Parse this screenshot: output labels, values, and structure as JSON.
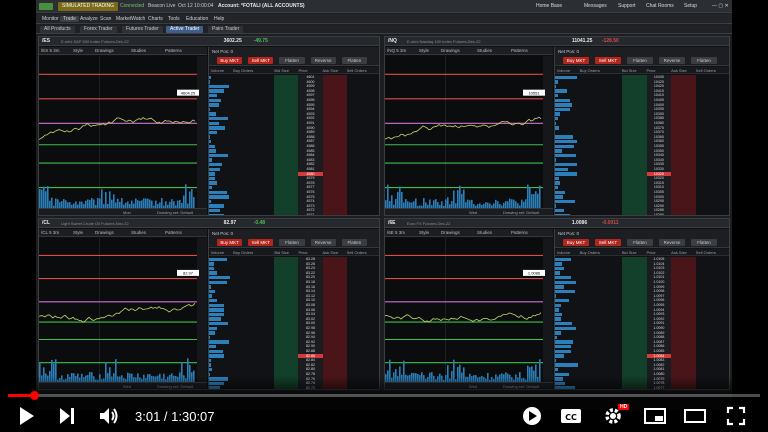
{
  "app": {
    "title_badge": "SIMULATED TRADING",
    "title_items": [
      "Connected",
      "Beacon Live",
      "Oct 12  10:00:04",
      "Account: *FOTALI (ALL ACCOUNTS)"
    ],
    "right_items": [
      "Home Base",
      "Messages",
      "Support",
      "Chat Rooms",
      "Setup"
    ],
    "menu": [
      "Monitor",
      "Trade",
      "Analyze",
      "Scan",
      "MarketWatch",
      "Charts",
      "Tools",
      "Education",
      "Help"
    ],
    "menu_active": "Trade",
    "subtabs": [
      "All Products",
      "Forex Trader",
      "Futures Trader",
      "Active Trader",
      "Pairs Trader"
    ],
    "accent": "#4a8f3c"
  },
  "panels": [
    {
      "symbol": "/ES",
      "description": "E-mini S&P 500 Index Futures,Dec-22",
      "price": "3602.25",
      "change": "-49.75",
      "chart_toolbar": [
        "/ES 5 3m",
        "Style",
        "Drawings",
        "Studies",
        "Patterns"
      ],
      "footer": [
        "Drawing set: Default"
      ],
      "net_pos": "Net Pos: 0",
      "buttons": [
        "Buy MKT",
        "Sell MKT",
        "Flatten",
        "Reverse",
        "Flatten"
      ],
      "col_headers": [
        "Volume",
        "Buy Orders",
        "Bid Size",
        "Price",
        "Ask Size",
        "Sell Orders"
      ],
      "prices": [
        "4601",
        "4600",
        "4599",
        "4598",
        "4597",
        "4596",
        "4595",
        "4594",
        "4593",
        "4592",
        "4591",
        "4590",
        "4589",
        "4588",
        "4587",
        "4586",
        "4585",
        "4584",
        "4583",
        "4582",
        "4581",
        "4580",
        "4579",
        "4578",
        "4577",
        "4576",
        "4575",
        "4574",
        "4573",
        "4572",
        "4571",
        "4570",
        "4569",
        "4568",
        "4567",
        "4566",
        "4565",
        "4564",
        "4563"
      ],
      "price_box": "4604.25",
      "chart_label": "Mon"
    },
    {
      "symbol": "/NQ",
      "description": "E-mini Nasdaq 100 Index Futures,Dec-22",
      "price": "11041.25",
      "change": "-128.50",
      "chart_toolbar": [
        "/NQ 5 3m",
        "Style",
        "Drawings",
        "Studies",
        "Patterns"
      ],
      "footer": [
        "Drawing set: Default"
      ],
      "net_pos": "Net Pos: 0",
      "buttons": [
        "Buy MKT",
        "Sell MKT",
        "Flatten",
        "Reverse",
        "Flatten"
      ],
      "col_headers": [
        "Volume",
        "Buy Orders",
        "Bid Size",
        "Price",
        "Ask Size",
        "Sell Orders"
      ],
      "summary": [
        "0",
        "0",
        "N/A",
        "0",
        "0"
      ],
      "prices": [
        "10430",
        "10425",
        "10420",
        "10415",
        "10410",
        "10405",
        "10400",
        "10395",
        "10390",
        "10385",
        "10380",
        "10375",
        "10370",
        "10365",
        "10360",
        "10355",
        "10350",
        "10345",
        "10340",
        "10335",
        "10330",
        "10325",
        "10320",
        "10315",
        "10310",
        "10305",
        "10300",
        "10295",
        "10290",
        "10285",
        "10280",
        "10275",
        "10270",
        "10265",
        "10260",
        "10255",
        "10250",
        "10245",
        "10240"
      ],
      "price_box": "10551",
      "chart_label": "Wed"
    },
    {
      "symbol": "/CL",
      "description": "Light Sweet Crude Oil Futures,Nov-22",
      "price": "82.97",
      "change": "-0.48",
      "chart_toolbar": [
        "/CL 5 3m",
        "Style",
        "Drawings",
        "Studies",
        "Patterns"
      ],
      "footer": [
        "Drawing set: Default"
      ],
      "net_pos": "Net Pos: 0",
      "buttons": [
        "Buy MKT",
        "Sell MKT",
        "Flatten",
        "Reverse",
        "Flatten"
      ],
      "col_headers": [
        "Volume",
        "Buy Orders",
        "Bid Size",
        "Price",
        "Ask Size",
        "Sell Orders"
      ],
      "summary": [
        "0",
        "0",
        "N/A",
        "0",
        "0"
      ],
      "prices": [
        "83.28",
        "83.26",
        "83.24",
        "83.22",
        "83.20",
        "83.18",
        "83.16",
        "83.14",
        "83.12",
        "83.10",
        "83.08",
        "83.06",
        "83.04",
        "83.02",
        "83.00",
        "82.98",
        "82.96",
        "82.94",
        "82.92",
        "82.90",
        "82.88",
        "82.86",
        "82.84",
        "82.82",
        "82.80",
        "82.78",
        "82.76",
        "82.74",
        "82.72",
        "82.70",
        "82.68",
        "82.66",
        "82.64",
        "82.62",
        "82.60",
        "82.58",
        "82.56",
        "82.54",
        "82.52"
      ],
      "price_box": "82.97",
      "chart_label": "Wed"
    },
    {
      "symbol": "/6E",
      "description": "Euro FX Futures,Dec-22",
      "price": "1.0086",
      "change": "-0.0011",
      "chart_toolbar": [
        "/6E 5 3m",
        "Style",
        "Drawings",
        "Studies",
        "Patterns"
      ],
      "footer": [
        "Drawing set: Default"
      ],
      "net_pos": "Net Pos: 0",
      "buttons": [
        "Buy MKT",
        "Sell MKT",
        "Flatten",
        "Reverse",
        "Flatten"
      ],
      "col_headers": [
        "Volume",
        "Buy Orders",
        "Bid Size",
        "Price",
        "Ask Size",
        "Sell Orders"
      ],
      "summary": [
        "0",
        "0",
        "N/A",
        "0",
        "0"
      ],
      "prices": [
        "1.0105",
        "1.0104",
        "1.0103",
        "1.0102",
        "1.0101",
        "1.0100",
        "1.0099",
        "1.0098",
        "1.0097",
        "1.0096",
        "1.0095",
        "1.0094",
        "1.0093",
        "1.0092",
        "1.0091",
        "1.0090",
        "1.0089",
        "1.0088",
        "1.0087",
        "1.0086",
        "1.0085",
        "1.0084",
        "1.0083",
        "1.0082",
        "1.0081",
        "1.0080",
        "1.0079",
        "1.0078",
        "1.0077",
        "1.0076",
        "1.0075",
        "1.0074",
        "1.0073",
        "1.0072",
        "1.0071",
        "1.0070",
        "1.0069",
        "1.0068",
        "1.0067"
      ],
      "price_box": "1.0086",
      "chart_label": "Wed"
    }
  ],
  "player": {
    "time": "3:01 / 1:30:07",
    "progress": 0.034,
    "hd_badge": "HD",
    "accent": "#ff0000"
  }
}
